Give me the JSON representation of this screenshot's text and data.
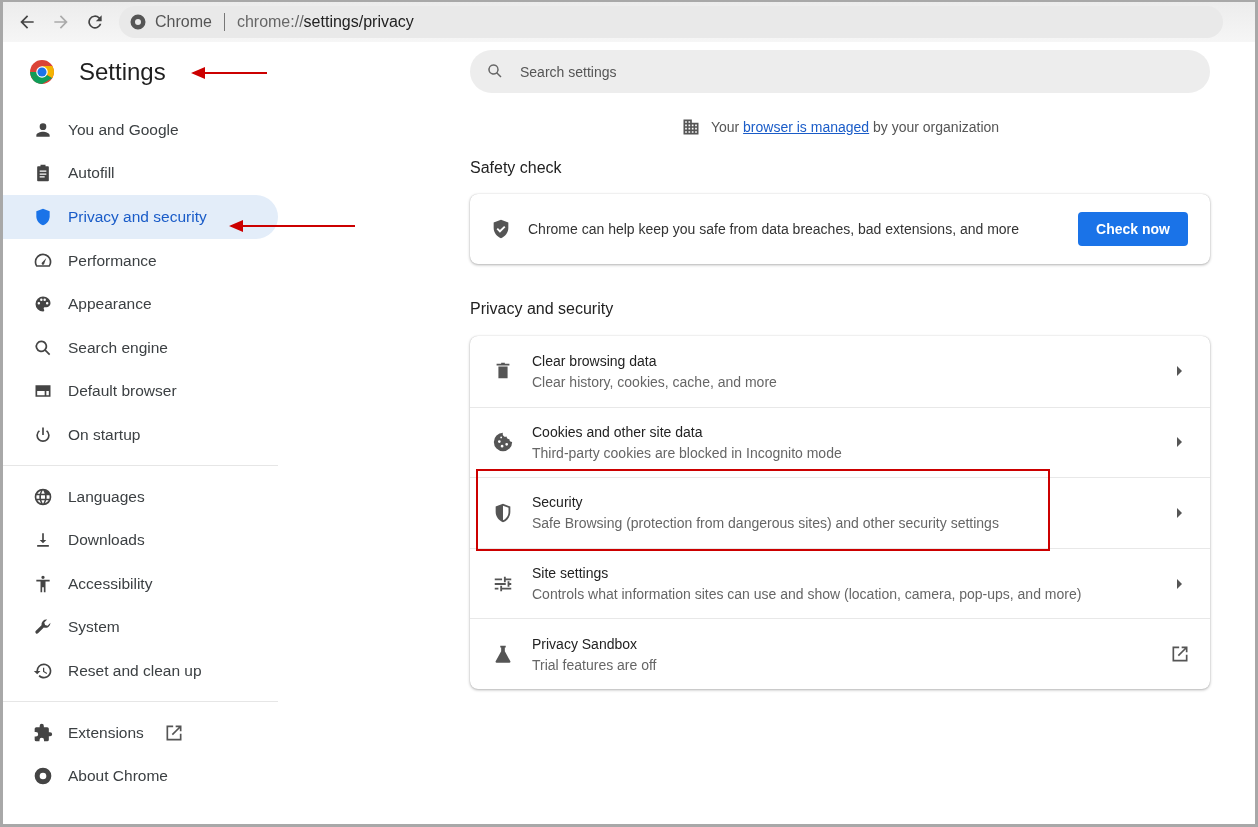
{
  "toolbar": {
    "site_label": "Chrome",
    "url_prefix": "chrome://",
    "url_path": "settings/privacy"
  },
  "header": {
    "title": "Settings"
  },
  "search": {
    "placeholder": "Search settings"
  },
  "sidebar": {
    "groups": [
      [
        {
          "label": "You and Google",
          "selected": false,
          "kind": "page"
        },
        {
          "label": "Autofill",
          "selected": false,
          "kind": "page"
        },
        {
          "label": "Privacy and security",
          "selected": true,
          "kind": "page"
        },
        {
          "label": "Performance",
          "selected": false,
          "kind": "page"
        },
        {
          "label": "Appearance",
          "selected": false,
          "kind": "page"
        },
        {
          "label": "Search engine",
          "selected": false,
          "kind": "page"
        },
        {
          "label": "Default browser",
          "selected": false,
          "kind": "page"
        },
        {
          "label": "On startup",
          "selected": false,
          "kind": "page"
        }
      ],
      [
        {
          "label": "Languages",
          "selected": false,
          "kind": "page"
        },
        {
          "label": "Downloads",
          "selected": false,
          "kind": "page"
        },
        {
          "label": "Accessibility",
          "selected": false,
          "kind": "page"
        },
        {
          "label": "System",
          "selected": false,
          "kind": "page"
        },
        {
          "label": "Reset and clean up",
          "selected": false,
          "kind": "page"
        }
      ],
      [
        {
          "label": "Extensions",
          "selected": false,
          "kind": "external"
        },
        {
          "label": "About Chrome",
          "selected": false,
          "kind": "page"
        }
      ]
    ]
  },
  "managed_notice": {
    "before": "Your",
    "link": "browser is managed",
    "after": "by your organization"
  },
  "safety_check": {
    "heading": "Safety check",
    "text": "Chrome can help keep you safe from data breaches, bad extensions, and more",
    "button": "Check now"
  },
  "privacy": {
    "heading": "Privacy and security",
    "rows": [
      {
        "title": "Clear browsing data",
        "subtitle": "Clear history, cookies, cache, and more",
        "kind": "submenu"
      },
      {
        "title": "Cookies and other site data",
        "subtitle": "Third-party cookies are blocked in Incognito mode",
        "kind": "submenu"
      },
      {
        "title": "Security",
        "subtitle": "Safe Browsing (protection from dangerous sites) and other security settings",
        "kind": "submenu"
      },
      {
        "title": "Site settings",
        "subtitle": "Controls what information sites can use and show (location, camera, pop-ups, and more)",
        "kind": "submenu"
      },
      {
        "title": "Privacy Sandbox",
        "subtitle": "Trial features are off",
        "kind": "external"
      }
    ]
  }
}
